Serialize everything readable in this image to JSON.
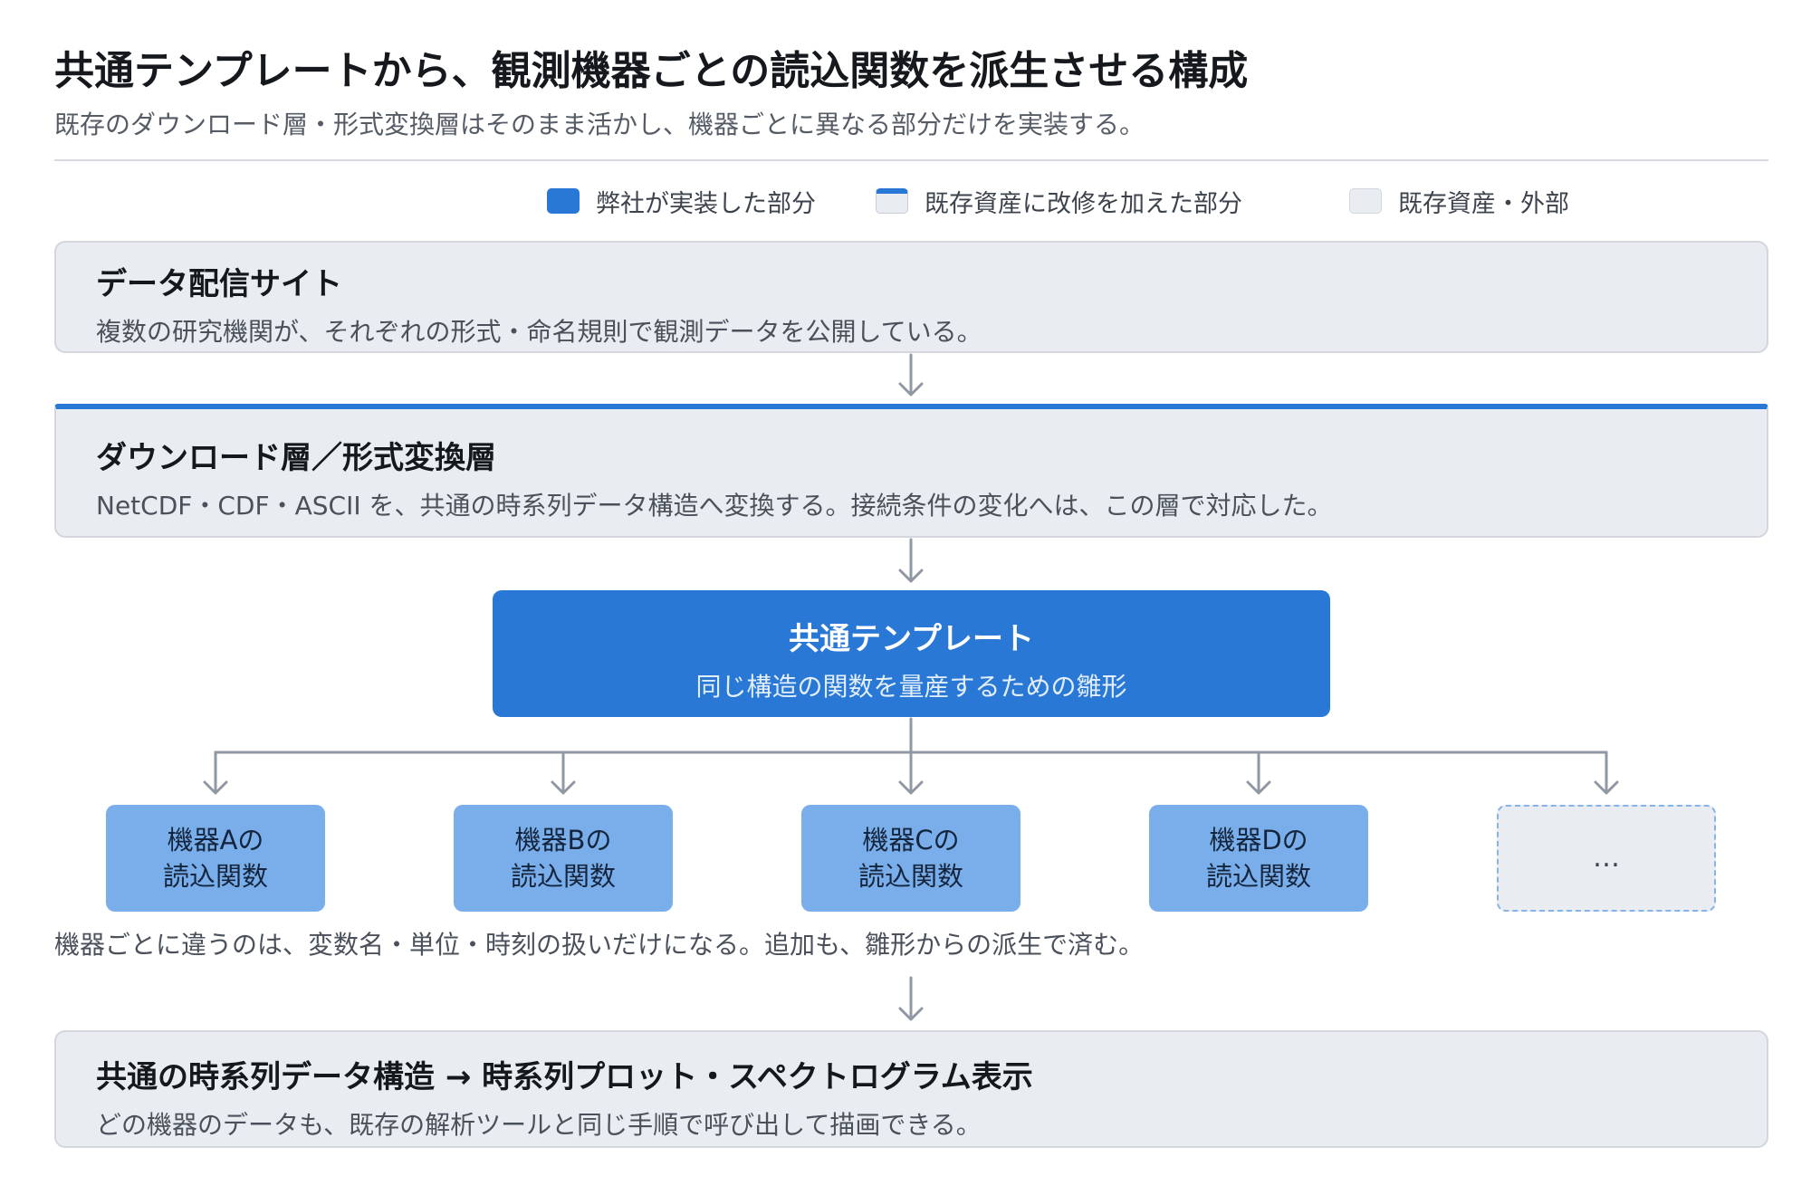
{
  "header": {
    "title": "共通テンプレートから、観測機器ごとの読込関数を派生させる構成",
    "subtitle": "既存のダウンロード層・形式変換層はそのまま活かし、機器ごとに異なる部分だけを実装する。"
  },
  "legend": [
    {
      "label": "弊社が実装した部分",
      "kind": "own"
    },
    {
      "label": "既存資産に改修を加えた部分",
      "kind": "modified"
    },
    {
      "label": "既存資産・外部",
      "kind": "external"
    }
  ],
  "layers": {
    "source": {
      "title": "データ配信サイト",
      "desc": "複数の研究機関が、それぞれの形式・命名規則で観測データを公開している。"
    },
    "download": {
      "title": "ダウンロード層／形式変換層",
      "desc": "NetCDF・CDF・ASCII を、共通の時系列データ構造へ変換する。接続条件の変化へは、この層で対応した。"
    },
    "template": {
      "title": "共通テンプレート",
      "desc": "同じ構造の関数を量産するための雛形"
    },
    "output": {
      "title": "共通の時系列データ構造 → 時系列プロット・スペクトログラム表示",
      "desc": "どの機器のデータも、既存の解析ツールと同じ手順で呼び出して描画できる。"
    }
  },
  "instruments": [
    {
      "line1": "機器Aの",
      "line2": "読込関数"
    },
    {
      "line1": "機器Bの",
      "line2": "読込関数"
    },
    {
      "line1": "機器Cの",
      "line2": "読込関数"
    },
    {
      "line1": "機器Dの",
      "line2": "読込関数"
    }
  ],
  "more_label": "…",
  "note": "機器ごとに違うのは、変数名・単位・時刻の扱いだけになる。追加も、雛形からの派生で済む。",
  "colors": {
    "accent": "#2a78d6",
    "instrument": "#7aaeea",
    "layer_bg": "#e9ecf0",
    "connector": "#8f98a3"
  }
}
